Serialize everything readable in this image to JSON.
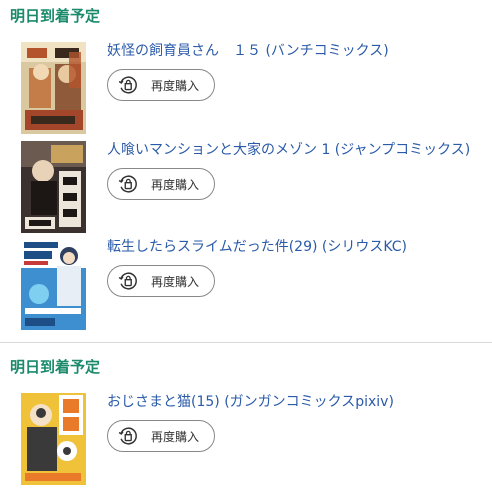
{
  "groups": [
    {
      "heading": "明日到着予定",
      "items": [
        {
          "title": "妖怪の飼育員さん　１５ (バンチコミックス)",
          "button_label": "再度購入",
          "cover_colors": {
            "bg": "#d9c8a0",
            "accent": "#b3542c",
            "dark": "#3a2a1e"
          }
        },
        {
          "title": "人喰いマンションと大家のメゾン 1 (ジャンプコミックス)",
          "button_label": "再度購入",
          "cover_colors": {
            "bg": "#3b3230",
            "accent": "#c9a25e",
            "dark": "#1c1614"
          }
        },
        {
          "title": "転生したらスライムだった件(29) (シリウスKC)",
          "button_label": "再度購入",
          "cover_colors": {
            "bg": "#3e8fcf",
            "accent": "#ffffff",
            "dark": "#1d4f86"
          }
        }
      ]
    },
    {
      "heading": "明日到着予定",
      "items": [
        {
          "title": "おじさまと猫(15) (ガンガンコミックスpixiv)",
          "button_label": "再度購入",
          "cover_colors": {
            "bg": "#f0c23a",
            "accent": "#e97a2a",
            "dark": "#3a3a3a"
          }
        }
      ]
    }
  ],
  "colors": {
    "heading": "#1a8a6b",
    "link": "#2a5aa8",
    "button_border": "#888888"
  },
  "icons": {
    "rebuy": "rebuy-cart-icon"
  }
}
